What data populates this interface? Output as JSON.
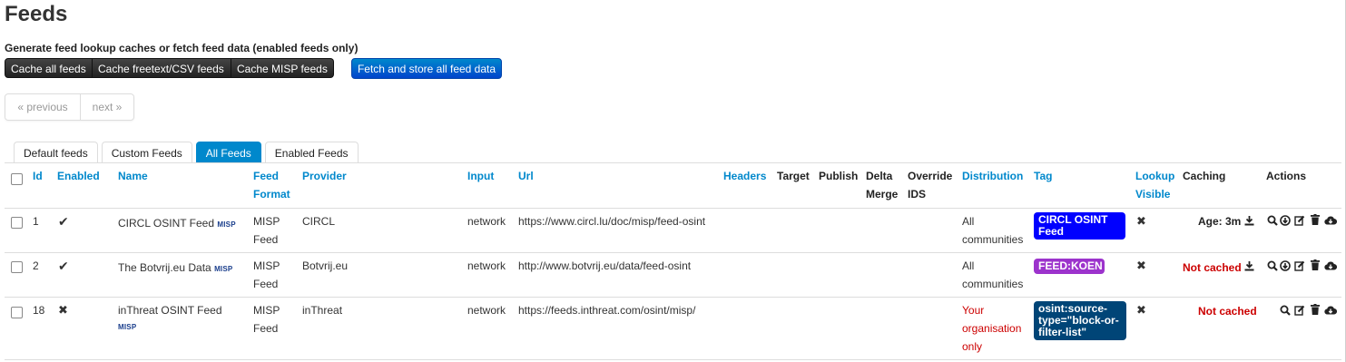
{
  "page": {
    "title": "Feeds",
    "subtitle": "Generate feed lookup caches or fetch feed data (enabled feeds only)"
  },
  "toolbar": {
    "cache_all_label": "Cache all feeds",
    "cache_freetext_label": "Cache freetext/CSV feeds",
    "cache_misp_label": "Cache MISP feeds",
    "fetch_all_label": "Fetch and store all feed data"
  },
  "pagination": {
    "previous_label": "« previous",
    "next_label": "next »"
  },
  "tabs": [
    {
      "label": "Default feeds"
    },
    {
      "label": "Custom Feeds"
    },
    {
      "label": "All Feeds",
      "active": true
    },
    {
      "label": "Enabled Feeds"
    }
  ],
  "table": {
    "columns": {
      "id": "Id",
      "enabled": "Enabled",
      "name": "Name",
      "feed_format_1": "Feed",
      "feed_format_2": "Format",
      "provider": "Provider",
      "input": "Input",
      "url": "Url",
      "headers": "Headers",
      "target": "Target",
      "publish": "Publish",
      "delta_merge_1": "Delta",
      "delta_merge_2": "Merge",
      "override_ids_1": "Override",
      "override_ids_2": "IDS",
      "distribution": "Distribution",
      "tag": "Tag",
      "lookup_visible_1": "Lookup",
      "lookup_visible_2": "Visible",
      "caching": "Caching",
      "actions": "Actions"
    },
    "rows": [
      {
        "id": "1",
        "enabled": "✔",
        "name": "CIRCL OSINT Feed",
        "badge": "MISP",
        "format_1": "MISP",
        "format_2": "Feed",
        "provider": "CIRCL",
        "input": "network",
        "url": "https://www.circl.lu/doc/misp/feed-osint",
        "distribution_1": "All",
        "distribution_2": "communities",
        "tag_1": "CIRCL OSINT",
        "tag_2": "Feed",
        "tag_color": "#0000ff",
        "lookup_visible": "✖",
        "caching": "Age: 3m"
      },
      {
        "id": "2",
        "enabled": "✔",
        "name": "The Botvrij.eu Data",
        "badge": "MISP",
        "format_1": "MISP",
        "format_2": "Feed",
        "provider": "Botvrij.eu",
        "input": "network",
        "url": "http://www.botvrij.eu/data/feed-osint",
        "distribution_1": "All",
        "distribution_2": "communities",
        "tag_1": "FEED:KOEN",
        "tag_color": "#9c33cc",
        "lookup_visible": "✖",
        "caching": "Not cached"
      },
      {
        "id": "18",
        "enabled": "✖",
        "name": "inThreat OSINT Feed",
        "badge": "MISP",
        "format_1": "MISP",
        "format_2": "Feed",
        "provider": "inThreat",
        "input": "network",
        "url": "https://feeds.inthreat.com/osint/misp/",
        "distribution_1": "Your",
        "distribution_2": "organisation",
        "distribution_3": "only",
        "tag_1": "osint:source-",
        "tag_2": "type=\"block-or-",
        "tag_3": "filter-list\"",
        "tag_color": "#004577",
        "lookup_visible": "✖",
        "caching": "Not cached"
      }
    ]
  },
  "colors": {
    "link": "#0088cc",
    "primary_button": "#0066cc",
    "dark_button": "#333333",
    "not_cached": "#cc0000"
  },
  "icons": [
    "checkbox",
    "search-icon",
    "download-icon",
    "edit-icon",
    "trash-icon",
    "cloud-download-icon",
    "check-icon",
    "cross-icon",
    "save-icon"
  ]
}
